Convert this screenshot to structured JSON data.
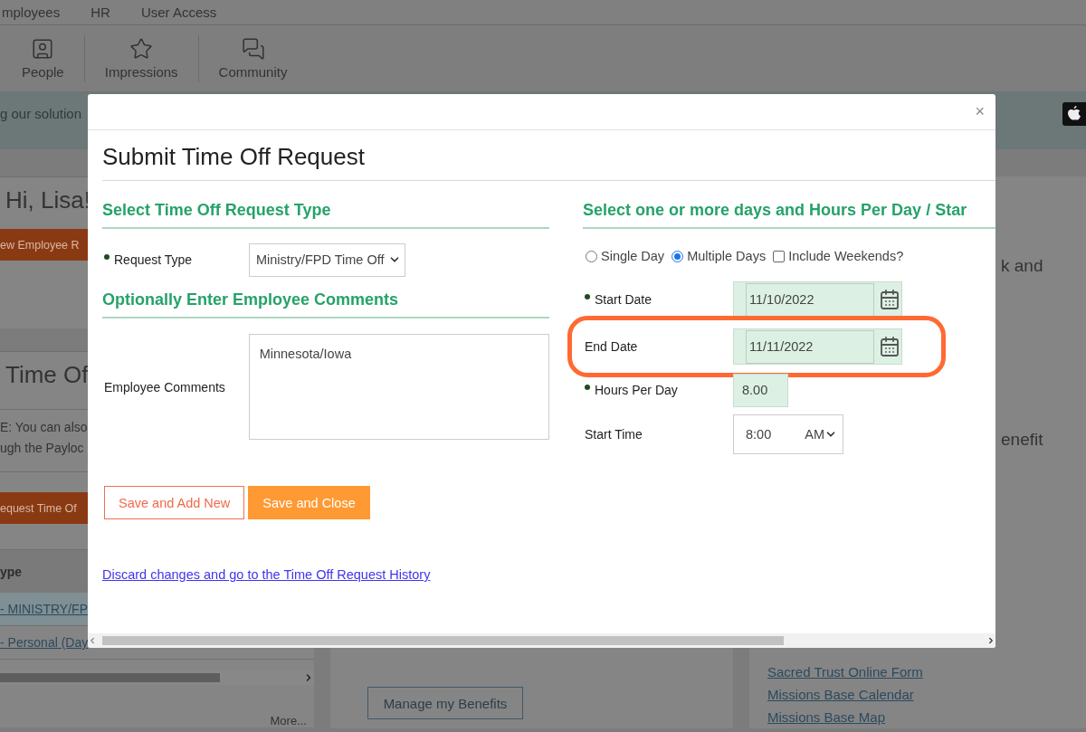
{
  "top_nav": {
    "items": [
      "mployees",
      "HR",
      "User Access"
    ]
  },
  "toolbar": {
    "items": [
      {
        "label": "People",
        "kind": "person"
      },
      {
        "label": "Impressions",
        "kind": "star"
      },
      {
        "label": "Community",
        "kind": "chat"
      }
    ]
  },
  "banner": {
    "text": "g our solution"
  },
  "left_panel": {
    "greeting": "Hi, Lisa!",
    "new_employee_button": "ew Employee R",
    "section_title": "Time Of",
    "note_lines": [
      "E: You can also",
      "ugh the Payloc"
    ],
    "request_button": "equest Time Of",
    "table": {
      "column_1": "ype",
      "rows": [
        {
          "link": "- MINISTRY/FP",
          "selected": true
        },
        {
          "link": "- Personal (Day",
          "selected": false
        }
      ]
    },
    "more_link": "More..."
  },
  "middle_panel": {
    "button": "Manage my Benefits"
  },
  "right_panel": {
    "texts": [
      "k and",
      "enefit"
    ],
    "links": [
      "Sacred Trust Online Form",
      "Missions Base Calendar",
      "Missions Base Map"
    ]
  },
  "dialog": {
    "close": "×",
    "title": "Submit Time Off Request",
    "type_section": {
      "heading": "Select Time Off Request Type",
      "field": {
        "label": "Request Type",
        "required": true,
        "value": "Ministry/FPD Time Off"
      }
    },
    "comments_section": {
      "heading": "Optionally Enter Employee Comments",
      "label": "Employee Comments",
      "value": "Minnesota/Iowa"
    },
    "buttons": [
      {
        "label": "Save and Add New",
        "kind": "outline"
      },
      {
        "label": "Save and Close",
        "kind": "primary"
      }
    ],
    "discard_link": "Discard changes and go to the Time Off Request History",
    "days_section": {
      "heading": "Select one or more days and Hours Per Day / Star",
      "options": [
        {
          "label": "Single Day",
          "kind": "radio",
          "checked": false
        },
        {
          "label": "Multiple Days",
          "kind": "radio",
          "checked": true
        },
        {
          "label": "Include Weekends?",
          "kind": "checkbox",
          "checked": false
        }
      ],
      "fields": [
        {
          "label": "Start Date",
          "required": true,
          "kind": "date",
          "value": "11/10/2022",
          "highlighted": false
        },
        {
          "label": "End Date",
          "required": false,
          "kind": "date",
          "value": "11/11/2022",
          "highlighted": true
        },
        {
          "label": "Hours Per Day",
          "required": true,
          "kind": "number",
          "value": "8.00",
          "highlighted": false
        },
        {
          "label": "Start Time",
          "required": false,
          "kind": "time",
          "value": "8:00",
          "period": "AM",
          "highlighted": false
        }
      ]
    }
  }
}
